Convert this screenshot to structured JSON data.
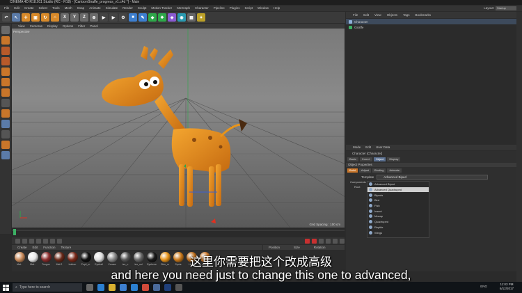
{
  "window": {
    "title": "CINEMA 4D R18.011 Studio (RC - R18) - [CartoonGiraffe_progress_v1.c4d *] - Main"
  },
  "main_menu": [
    "File",
    "Edit",
    "Create",
    "Select",
    "Tools",
    "Mesh",
    "Snap",
    "Animate",
    "Simulate",
    "Render",
    "Sculpt",
    "Motion Tracker",
    "MoGraph",
    "Character",
    "Pipeline",
    "Plugins",
    "Script",
    "Window",
    "Help"
  ],
  "layout": {
    "label": "Layout:",
    "value": "Startup"
  },
  "viewport": {
    "menu": [
      "View",
      "Cameras",
      "Display",
      "Options",
      "Filter",
      "Panel"
    ],
    "camera_label": "Perspective",
    "grid_spacing": "Grid Spacing : 100 cm"
  },
  "material_menu": [
    "Create",
    "Edit",
    "Function",
    "Texture"
  ],
  "materials": [
    {
      "label": "Mat..",
      "color": "#c98a5a"
    },
    {
      "label": "Mat..",
      "color": "#e8e8e8"
    },
    {
      "label": "Tongue",
      "color": "#8b2c2c"
    },
    {
      "label": "Mat.2",
      "color": "#6a2a1a"
    },
    {
      "label": "bottom",
      "color": "#7a2a1a"
    },
    {
      "label": "Pupil_m",
      "color": "#111111"
    },
    {
      "label": "Eyeball",
      "color": "#dddddd"
    },
    {
      "label": "Crease",
      "color": "#888888"
    },
    {
      "label": "tex_n",
      "color": "#555555"
    },
    {
      "label": "tex_sul",
      "color": "#666666"
    },
    {
      "label": "Eyebrow",
      "color": "#1a1a1a"
    },
    {
      "label": "Skin_m",
      "color": "#e8941a"
    },
    {
      "label": "Spots",
      "color": "#c8781a"
    },
    {
      "label": "Horn",
      "color": "#b86a1a"
    },
    {
      "label": "Mat..",
      "color": "#c9762a"
    }
  ],
  "coords_header": [
    "Position",
    "Size",
    "Rotation"
  ],
  "object_manager": {
    "menu": [
      "File",
      "Edit",
      "View",
      "Objects",
      "Tags",
      "Bookmarks"
    ],
    "objects": [
      {
        "name": "Character",
        "selected": true
      },
      {
        "name": "Giraffe",
        "selected": false
      }
    ]
  },
  "attributes": {
    "menu": [
      "Mode",
      "Edit",
      "User Data"
    ],
    "title": "Character [Character]",
    "tabs": [
      "Basic",
      "Coord.",
      "Object",
      "Display"
    ],
    "section": "Object Properties",
    "subtabs": [
      "Build",
      "Adjust",
      "Binding",
      "Animate"
    ],
    "template_label": "Template",
    "template_value": "Advanced Biped",
    "components_label": "Components",
    "root_label": "Root",
    "dropdown_items": [
      "Advanced Biped",
      "Advanced Quadruped",
      "Bipeds",
      "Bird",
      "Fish",
      "Insect",
      "Mocap",
      "Quadruped",
      "Reptile",
      "Wings"
    ],
    "highlighted_item": "Advanced Quadruped"
  },
  "subtitles": {
    "chinese": "这里你需要把这个改成高级",
    "english": "and here you need just to change this one to advanced,"
  },
  "taskbar": {
    "search_placeholder": "Type here to search",
    "lang": "ENG",
    "time": "11:03 PM",
    "date": "6/12/2017"
  }
}
